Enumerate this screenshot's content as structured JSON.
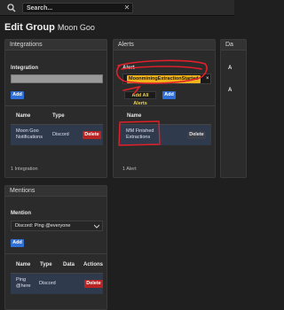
{
  "topbar": {
    "search_placeholder": "Search...",
    "clear_glyph": "✕"
  },
  "page": {
    "title": "Edit Group",
    "group_name": "Moon Goo"
  },
  "integrations": {
    "header": "Integrations",
    "field_label": "Integration",
    "add_label": "Add",
    "columns": [
      "Name",
      "Type"
    ],
    "rows": [
      {
        "name_line1": "Moon Goo",
        "name_line2": "Notifications",
        "type": "Discord",
        "action": "Delete"
      }
    ],
    "footer": "1 Integration"
  },
  "alerts": {
    "header": "Alerts",
    "field_label": "Alert",
    "selected_tag": "MoonminingExtractionStarted",
    "tag_remove": "×",
    "add_all_label": "Add All Alerts",
    "add_label": "Add",
    "columns": [
      "Name"
    ],
    "rows": [
      {
        "name_line1": "MM Finished",
        "name_line2": "Extractions",
        "action": "Delete"
      }
    ],
    "footer": "1 Alert"
  },
  "mentions": {
    "header": "Mentions",
    "field_label": "Mention",
    "select_value": "Discord: Ping @everyone",
    "add_label": "Add",
    "columns": [
      "Name",
      "Type",
      "Data",
      "Actions"
    ],
    "rows": [
      {
        "name_line1": "Ping",
        "name_line2": "@here",
        "type": "Discord",
        "action": "Delete"
      }
    ]
  },
  "right_panel": {
    "header": "Da",
    "labels": [
      "A",
      "A"
    ]
  },
  "colors": {
    "accent_blue": "#2f6fd6",
    "danger_red": "#b82424",
    "tag_yellow": "#f0b31c",
    "annotation_red": "#e0202a"
  }
}
